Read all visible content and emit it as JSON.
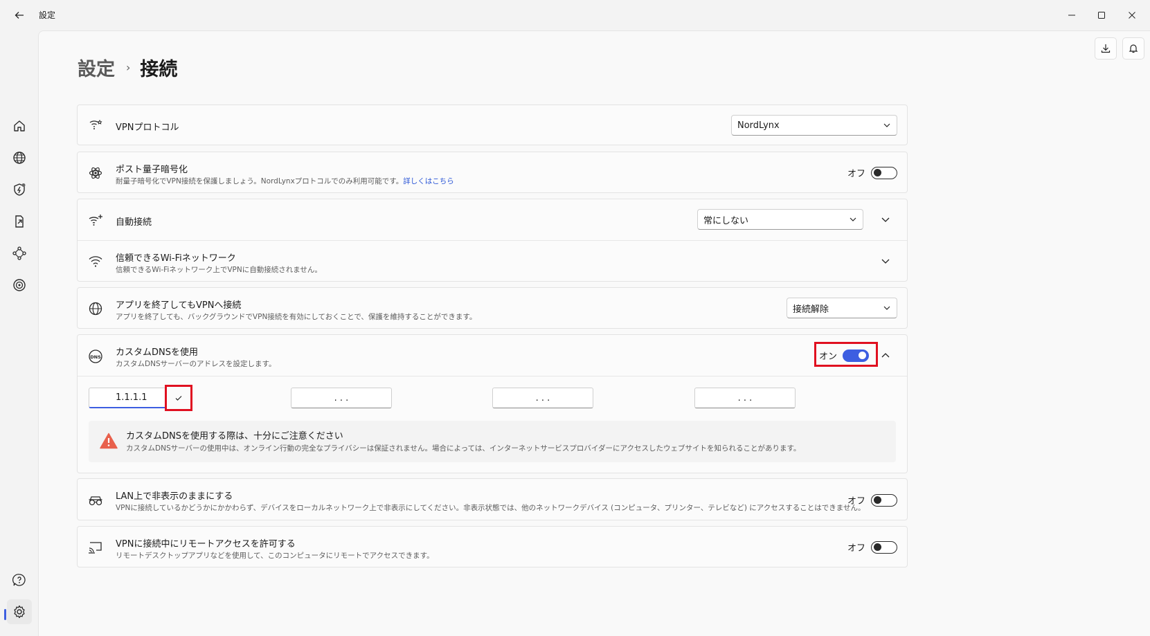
{
  "window": {
    "title": "設定"
  },
  "breadcrumb": {
    "parent": "設定",
    "current": "接続"
  },
  "settings": {
    "vpn_protocol": {
      "title": "VPNプロトコル",
      "value": "NordLynx"
    },
    "post_quantum": {
      "title": "ポスト量子暗号化",
      "subtitle": "耐量子暗号化でVPN接続を保護しましょう。NordLynxプロトコルでのみ利用可能です。",
      "link": "詳しくはこちら",
      "state": "オフ"
    },
    "auto_connect": {
      "title": "自動接続",
      "value": "常にしない"
    },
    "trusted_wifi": {
      "title": "信頼できるWi-Fiネットワーク",
      "subtitle": "信頼できるWi-Fiネットワーク上でVPNに自動接続されません。"
    },
    "stay_connected": {
      "title": "アプリを終了してもVPNへ接続",
      "subtitle": "アプリを終了しても、バックグラウンドでVPN接続を有効にしておくことで、保護を維持することができます。",
      "value": "接続解除"
    },
    "custom_dns": {
      "title": "カスタムDNSを使用",
      "subtitle": "カスタムDNSサーバーのアドレスを設定します。",
      "state": "オン",
      "fields": [
        "1.1.1.1",
        ".  .  .",
        ".  .  .",
        ".  .  ."
      ],
      "warning_title": "カスタムDNSを使用する際は、十分にご注意ください",
      "warning_body": "カスタムDNSサーバーの使用中は、オンライン行動の完全なプライバシーは保証されません。場合によっては、インターネットサービスプロバイダーにアクセスしたウェブサイトを知られることがあります。"
    },
    "lan_invisible": {
      "title": "LAN上で非表示のままにする",
      "subtitle": "VPNに接続しているかどうかにかかわらず、デバイスをローカルネットワーク上で非表示にしてください。非表示状態では、他のネットワークデバイス (コンピュータ、プリンター、テレビなど) にアクセスすることはできません。",
      "state": "オフ"
    },
    "remote_access": {
      "title": "VPNに接続中にリモートアクセスを許可する",
      "subtitle": "リモートデスクトップアプリなどを使用して、このコンピュータにリモートでアクセスできます。",
      "state": "オフ"
    }
  },
  "colors": {
    "accent": "#3d5ee1",
    "highlight": "#e01020",
    "warning": "#e8604c"
  }
}
